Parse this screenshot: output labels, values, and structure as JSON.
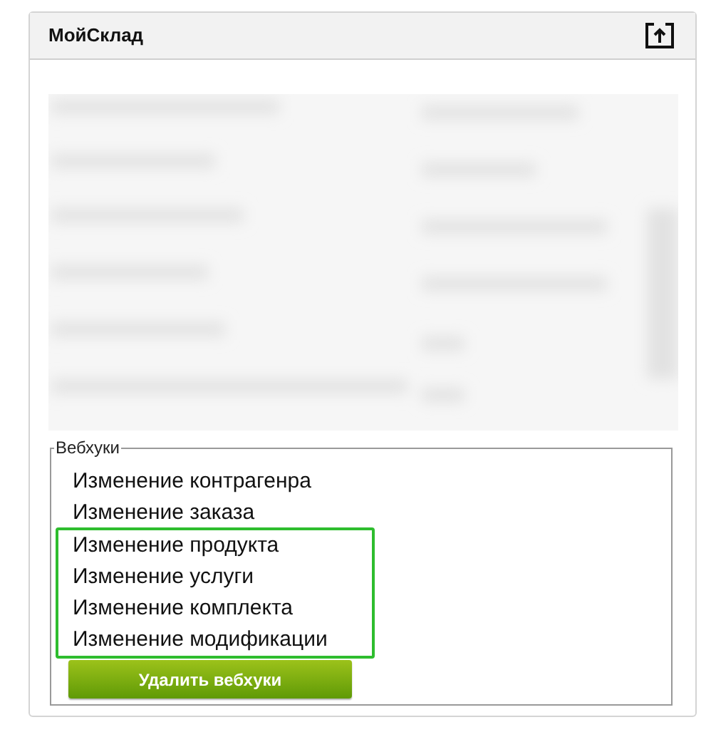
{
  "panel": {
    "title": "МойСклад"
  },
  "webhooks": {
    "legend": "Вебхуки",
    "items": [
      {
        "label": "Изменение контрагенра",
        "highlighted": false
      },
      {
        "label": "Изменение заказа",
        "highlighted": false
      },
      {
        "label": "Изменение продукта",
        "highlighted": true
      },
      {
        "label": "Изменение услуги",
        "highlighted": true
      },
      {
        "label": "Изменение комплекта",
        "highlighted": true
      },
      {
        "label": "Изменение модификации",
        "highlighted": true
      }
    ],
    "button": "Удалить вебхуки"
  }
}
